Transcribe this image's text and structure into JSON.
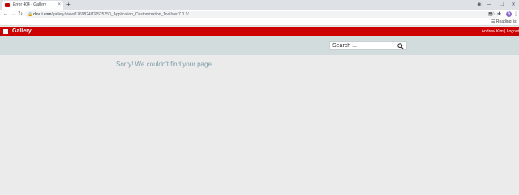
{
  "browser": {
    "tab": {
      "title": "Error 404 - Gallery",
      "close_symbol": "×"
    },
    "new_tab_symbol": "+",
    "window_controls": {
      "minimize": "—",
      "restore": "❐",
      "close": "✕"
    },
    "nav": {
      "back": "←",
      "forward": "→",
      "reload": "↻"
    },
    "address": {
      "lock": "🔒",
      "host": "dev.ti.com",
      "path": "/gallery/view/1769824/TPS25750_Application_Customization_Tool/ver/7.0.1/"
    },
    "star": "☆",
    "profile_initial": "A",
    "reading_list": "Reading list"
  },
  "site": {
    "title": "Gallery",
    "user_name": "Andrew Kim",
    "separator": " | ",
    "logout": "Logout",
    "brand_color": "#cc0000"
  },
  "search": {
    "placeholder": "Search ..."
  },
  "main": {
    "message": "Sorry! We couldn't find your page."
  }
}
